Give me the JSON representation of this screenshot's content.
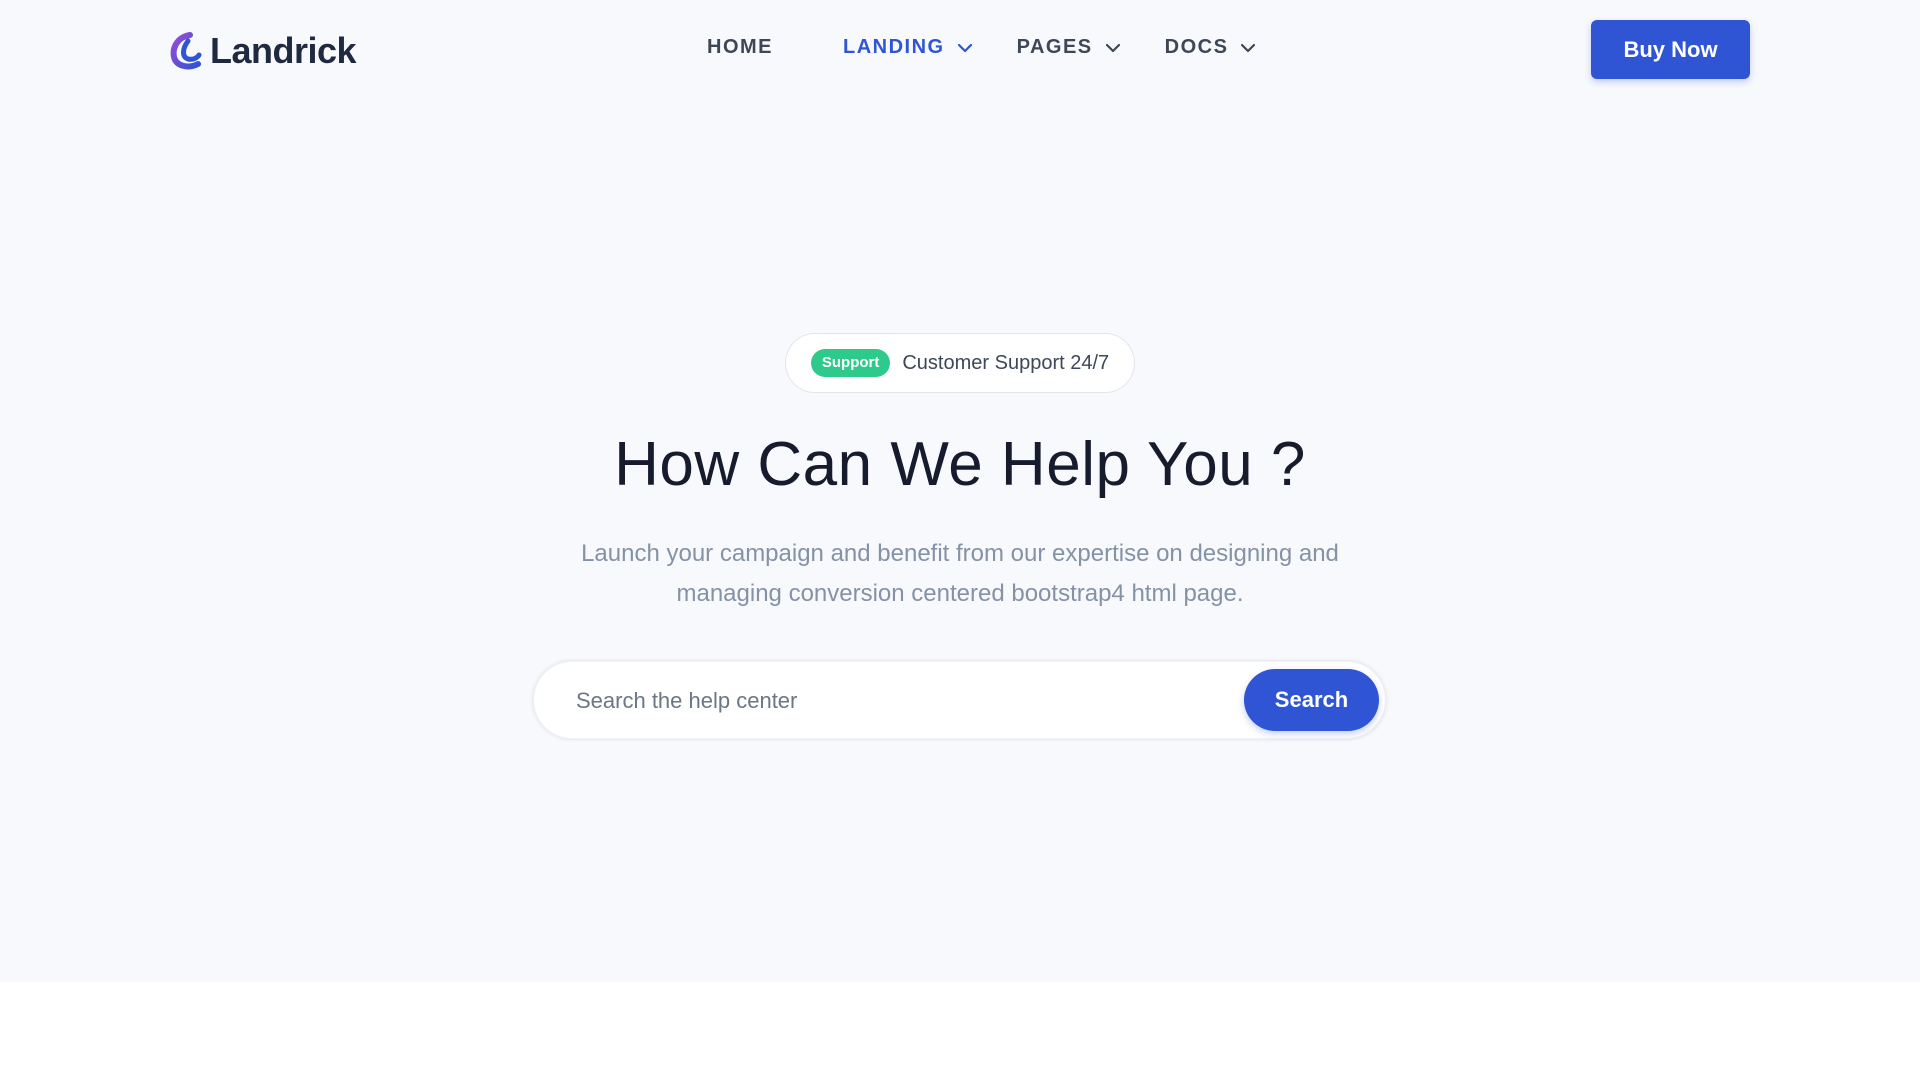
{
  "brand": {
    "name": "Landrick",
    "logo_icon": "landrick-logo-icon",
    "colors": {
      "primary": "#2f55d4",
      "logo_purple": "#7a45d6",
      "success": "#2eca8b",
      "dark": "#161c2d"
    }
  },
  "nav": {
    "items": [
      {
        "label": "HOME",
        "has_dropdown": false,
        "active": false
      },
      {
        "label": "LANDING",
        "has_dropdown": true,
        "active": true
      },
      {
        "label": "PAGES",
        "has_dropdown": true,
        "active": false
      },
      {
        "label": "DOCS",
        "has_dropdown": true,
        "active": false
      }
    ],
    "dropdown_icon": "chevron-down-icon",
    "cta_label": "Buy Now"
  },
  "hero": {
    "badge_label": "Support",
    "badge_text": "Customer Support 24/7",
    "title": "How Can We Help You ?",
    "subtitle_line1": "Launch your campaign and benefit from our expertise on designing and",
    "subtitle_line2": "managing conversion centered bootstrap4 html page.",
    "search": {
      "placeholder": "Search the help center",
      "value": "",
      "button_label": "Search"
    }
  }
}
